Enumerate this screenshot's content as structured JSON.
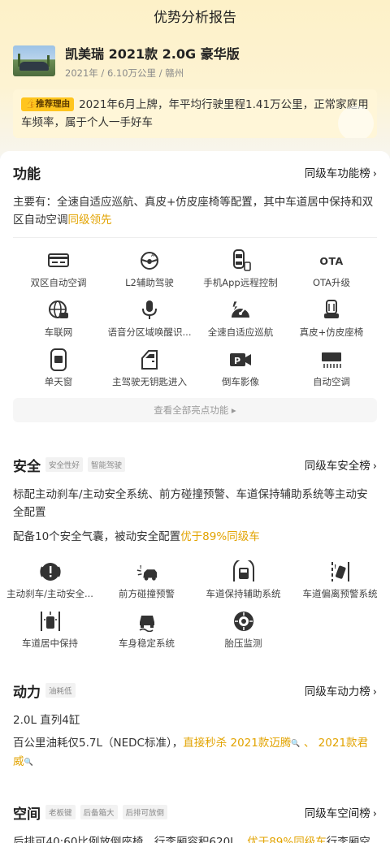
{
  "header": {
    "title": "优势分析报告"
  },
  "car": {
    "name": "凯美瑞 2021款 2.0G 豪华版",
    "meta": "2021年 / 6.10万公里 / 赣州"
  },
  "recommend": {
    "tag": "推荐理由",
    "text": "2021年6月上牌，年平均行驶里程1.41万公里，正常家庭用车频率，属于个人一手好车"
  },
  "function": {
    "title": "功能",
    "link": "同级车功能榜",
    "desc_main": "主要有：全速自适应巡航、真皮+仿皮座椅等配置，其中车道居中保持和双区自动空调",
    "desc_hl": "同级领先",
    "items": [
      {
        "label": "双区自动空调",
        "icon": "climate-control-icon"
      },
      {
        "label": "L2辅助驾驶",
        "icon": "steering-wheel-icon"
      },
      {
        "label": "手机App远程控制",
        "icon": "phone-car-icon"
      },
      {
        "label": "OTA升级",
        "icon": "ota-icon"
      },
      {
        "label": "车联网",
        "icon": "globe-car-icon"
      },
      {
        "label": "语音分区域唤醒识...",
        "icon": "microphone-icon"
      },
      {
        "label": "全速自适应巡航",
        "icon": "cruise-gauge-icon"
      },
      {
        "label": "真皮+仿皮座椅",
        "icon": "seat-icon"
      },
      {
        "label": "单天窗",
        "icon": "sunroof-icon"
      },
      {
        "label": "主驾驶无钥匙进入",
        "icon": "car-door-icon"
      },
      {
        "label": "倒车影像",
        "icon": "parking-camera-icon"
      },
      {
        "label": "自动空调",
        "icon": "ac-vent-icon"
      }
    ],
    "ota_text": "OTA",
    "more": "查看全部亮点功能 ▸"
  },
  "safety": {
    "title": "安全",
    "tags": [
      "安全性好",
      "智能驾驶"
    ],
    "link": "同级车安全榜",
    "desc1": "标配主动刹车/主动安全系统、前方碰撞预警、车道保持辅助系统等主动安全配置",
    "desc2_main": "配备10个安全气囊，被动安全配置",
    "desc2_hl": "优于89%同级车",
    "items": [
      {
        "label": "主动刹车/主动安全...",
        "icon": "brake-warning-icon"
      },
      {
        "label": "前方碰撞预警",
        "icon": "collision-warning-icon"
      },
      {
        "label": "车道保持辅助系统",
        "icon": "lane-keep-icon"
      },
      {
        "label": "车道偏离预警系统",
        "icon": "lane-departure-icon"
      },
      {
        "label": "车道居中保持",
        "icon": "lane-center-icon"
      },
      {
        "label": "车身稳定系统",
        "icon": "stability-icon"
      },
      {
        "label": "胎压监测",
        "icon": "tire-pressure-icon"
      }
    ]
  },
  "power": {
    "title": "动力",
    "tag": "油耗低",
    "link": "同级车动力榜",
    "engine": "2.0L 直列4缸",
    "fuel_main": "百公里油耗仅5.7L（NEDC标准），",
    "fuel_hl": "直接秒杀 2021款迈腾",
    "sep": " 、 ",
    "fuel_hl2": "2021款君威",
    "search_mark": "🔍"
  },
  "space": {
    "title": "空间",
    "tags": [
      "老板键",
      "后备箱大",
      "后排可放倒"
    ],
    "link": "同级车空间榜",
    "desc_main": "后排可40:60比例放倒座椅，行李厢容积620L，",
    "desc_hl": "优于89%同级车",
    "desc_tail": "行李厢空间"
  },
  "colors": {
    "accent": "#e2a300",
    "tag_yellow": "#ffc51e"
  }
}
